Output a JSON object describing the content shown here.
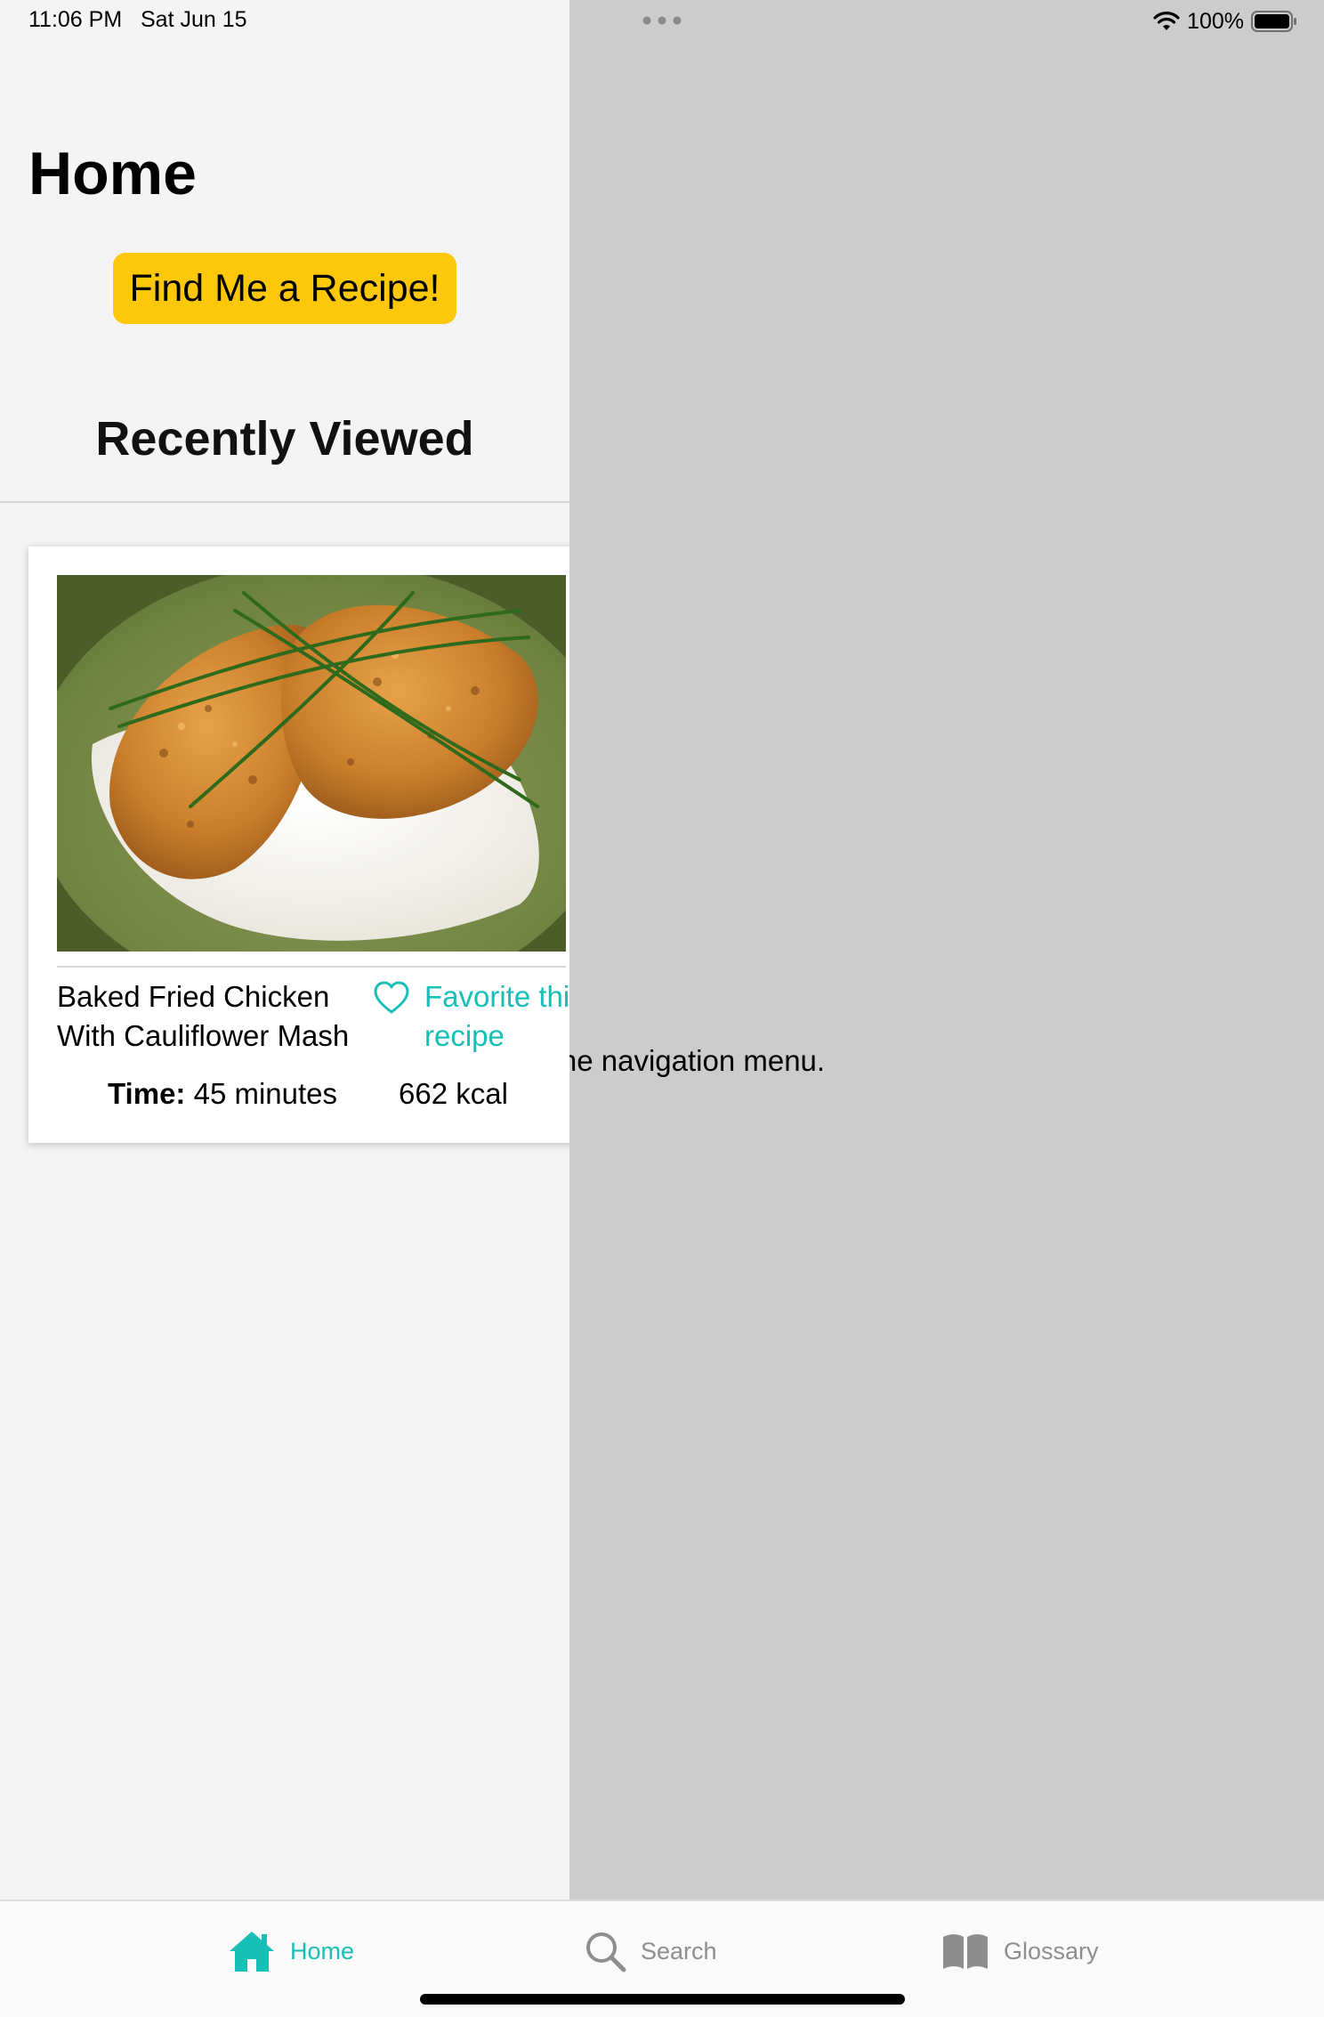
{
  "status_bar": {
    "time": "11:06 PM",
    "date": "Sat Jun 15",
    "battery": "100%"
  },
  "master": {
    "title": "Home",
    "find_button": "Find Me a Recipe!",
    "recently_viewed": "Recently Viewed"
  },
  "recipe": {
    "name": "Baked Fried Chicken With Cauliflower Mash",
    "favorite": "Favorite this recipe",
    "time_label": "Time:",
    "time_value": "45 minutes",
    "calories": "662 kcal"
  },
  "detail": {
    "message": "e from the navigation menu."
  },
  "tabs": [
    {
      "label": "Home",
      "icon": "home-icon",
      "active": true
    },
    {
      "label": "Search",
      "icon": "search-icon",
      "active": false
    },
    {
      "label": "Glossary",
      "icon": "book-icon",
      "active": false
    }
  ],
  "colors": {
    "accent": "#17bfb6",
    "button": "#fdc80a",
    "master_bg": "#f4f4f4",
    "detail_bg": "#cccccc",
    "inactive_tab": "#8e8e8e"
  }
}
